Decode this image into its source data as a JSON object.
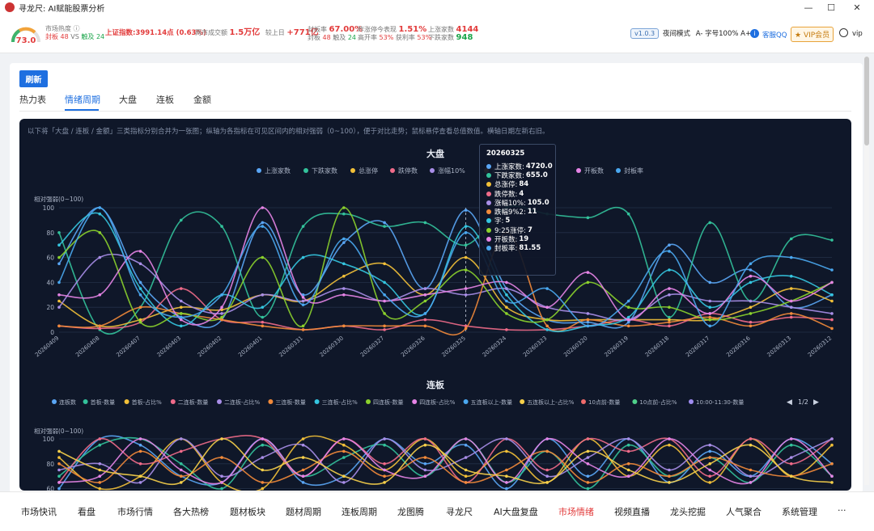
{
  "window": {
    "title": "寻龙尺: AI赋能股票分析",
    "controls": [
      "—",
      "☐",
      "✕"
    ]
  },
  "topbar": {
    "heat_label": "市场热度",
    "heat_value": "73.0",
    "seal_text": "封板",
    "seal_num": "48",
    "vs": "VS",
    "break_text": "触及",
    "break_num": "24",
    "index_label": "上证指数:",
    "index_value": "3991.14点 (0.63%)",
    "turnover_label": "两市成交额",
    "turnover_value": "1.5万亿",
    "compare_label": "较上日",
    "compare_value": "+771亿",
    "seal_rate_label": "封板率",
    "seal_rate_value": "67.00%",
    "seal_rate_sub1": "封板",
    "seal_rate_sub1_num": "48",
    "seal_rate_sub2": "触及",
    "seal_rate_sub2_num": "24",
    "yest_label": "昨涨停今表现",
    "yest_value": "1.51%",
    "high_open_label": "高开率",
    "high_open_value": "53%",
    "profit_label": "获利率",
    "profit_value": "53%",
    "up_label": "上涨家数",
    "up_value": "4144",
    "down_label": "下跌家数",
    "down_value": "948",
    "version": "v1.0.3",
    "night_mode": "夜间模式",
    "font_minus": "A-",
    "font_size": "字号100%",
    "font_plus": "A+",
    "qq": "客服QQ",
    "vip_btn": "VIP会员",
    "user": "vip"
  },
  "page": {
    "refresh": "刷新",
    "tabs": [
      "热力表",
      "情绪周期",
      "大盘",
      "连板",
      "金额"
    ],
    "active_tab": 1,
    "description": "以下将「大盘 / 连板 / 金额」三类指标分别合并为一张图；纵轴为各指标在可见区间内的相对强弱（0~100），便于对比走势；鼠标悬停查看总值数值。横轴日期左新右旧。"
  },
  "tooltip": {
    "date": "20260325",
    "rows": [
      {
        "name": "上涨家数",
        "value": "4720.0",
        "color": "#5aa6f5"
      },
      {
        "name": "下跌家数",
        "value": "655.0",
        "color": "#33c29b"
      },
      {
        "name": "总涨停",
        "value": "84",
        "color": "#f2c038"
      },
      {
        "name": "跌停数",
        "value": "4",
        "color": "#f06b8a"
      },
      {
        "name": "涨幅10%",
        "value": "105.0",
        "color": "#a98ee8"
      },
      {
        "name": "跌幅9%2",
        "value": "11",
        "color": "#f28a3a"
      },
      {
        "name": "字",
        "value": "5",
        "color": "#35c6e0"
      },
      {
        "name": "9:25涨停",
        "value": "7",
        "color": "#8bd12c"
      },
      {
        "name": "开板数",
        "value": "19",
        "color": "#e684e6"
      },
      {
        "name": "封板率",
        "value": "81.55",
        "color": "#4aa8f0"
      }
    ]
  },
  "bottom_nav": [
    "市场快讯",
    "看盘",
    "市场行情",
    "各大热榜",
    "题材板块",
    "题材周期",
    "连板周期",
    "龙图腾",
    "寻龙尺",
    "AI大盘复盘",
    "市场情绪",
    "视频直播",
    "龙头挖掘",
    "人气聚合",
    "系统管理",
    "···"
  ],
  "bottom_active": 10,
  "chart_data": [
    {
      "type": "line",
      "title": "大盘",
      "ylabel": "相对强弱(0~100)",
      "ylim": [
        0,
        100
      ],
      "yticks": [
        0,
        20,
        40,
        60,
        80,
        100
      ],
      "categories": [
        "20260409",
        "20260408",
        "20260407",
        "20260403",
        "20260402",
        "20260401",
        "20260331",
        "20260330",
        "20260327",
        "20260326",
        "20260325",
        "20260324",
        "20260323",
        "20260320",
        "20260319",
        "20260318",
        "20260317",
        "20260316",
        "20260313",
        "20260312"
      ],
      "legend": [
        "上涨家数",
        "下跌家数",
        "总涨停",
        "跌停数",
        "涨幅10%",
        "跌幅9%",
        "",
        "",
        "开板数",
        "封板率"
      ],
      "legend_position": "top",
      "grid": true,
      "series": [
        {
          "name": "上涨家数",
          "color": "#5aa6f5",
          "values": [
            55,
            100,
            40,
            12,
            10,
            88,
            30,
            72,
            88,
            35,
            98,
            35,
            10,
            8,
            8,
            70,
            40,
            50,
            20,
            30
          ]
        },
        {
          "name": "下跌家数",
          "color": "#33c29b",
          "values": [
            80,
            2,
            20,
            90,
            85,
            12,
            85,
            95,
            85,
            88,
            70,
            100,
            95,
            92,
            95,
            12,
            88,
            25,
            75,
            74
          ]
        },
        {
          "name": "总涨停",
          "color": "#f2c038",
          "values": [
            25,
            5,
            10,
            20,
            18,
            30,
            25,
            45,
            55,
            30,
            60,
            20,
            10,
            10,
            10,
            10,
            10,
            20,
            35,
            25
          ]
        },
        {
          "name": "跌停数",
          "color": "#f06b8a",
          "values": [
            5,
            3,
            8,
            35,
            10,
            8,
            2,
            5,
            2,
            10,
            5,
            2,
            2,
            5,
            10,
            5,
            15,
            8,
            12,
            10
          ]
        },
        {
          "name": "涨幅10%",
          "color": "#a98ee8",
          "values": [
            20,
            60,
            55,
            25,
            15,
            30,
            25,
            35,
            25,
            35,
            30,
            35,
            20,
            15,
            10,
            30,
            25,
            25,
            20,
            15
          ]
        },
        {
          "name": "跌幅9%",
          "color": "#f28a3a",
          "values": [
            5,
            5,
            20,
            15,
            10,
            5,
            2,
            5,
            5,
            5,
            3,
            80,
            5,
            10,
            5,
            8,
            12,
            5,
            15,
            3
          ]
        },
        {
          "name": "",
          "color": "#35c6e0",
          "values": [
            70,
            95,
            35,
            5,
            30,
            20,
            60,
            55,
            40,
            15,
            85,
            30,
            2,
            5,
            12,
            50,
            20,
            40,
            45,
            30
          ]
        },
        {
          "name": "",
          "color": "#8bd12c",
          "values": [
            60,
            80,
            8,
            15,
            12,
            60,
            5,
            100,
            15,
            25,
            50,
            15,
            10,
            40,
            20,
            20,
            10,
            15,
            25,
            40
          ]
        },
        {
          "name": "开板数",
          "color": "#e684e6",
          "values": [
            30,
            30,
            65,
            10,
            20,
            100,
            28,
            30,
            25,
            30,
            35,
            40,
            20,
            48,
            10,
            35,
            15,
            45,
            25,
            40
          ]
        },
        {
          "name": "封板率",
          "color": "#4aa8f0",
          "values": [
            40,
            100,
            30,
            12,
            30,
            85,
            22,
            75,
            30,
            15,
            80,
            25,
            35,
            5,
            25,
            65,
            5,
            55,
            60,
            50
          ]
        }
      ]
    },
    {
      "type": "line",
      "title": "连板",
      "ylabel": "相对强弱(0~100)",
      "ylim": [
        0,
        100
      ],
      "yticks": [
        60,
        80,
        100
      ],
      "legend": [
        "连板数",
        "首板-数量",
        "首板-占比%",
        "二连板-数量",
        "二连板-占比%",
        "三连板-数量",
        "三连板-占比%",
        "四连板-数量",
        "四连板-占比%",
        "五连板以上-数量",
        "五连板以上-占比%",
        "10点前-数量",
        "10点前-占比%",
        "10:00-11:30-数量"
      ],
      "legend_page": "1/2",
      "grid": true,
      "series": [
        {
          "name": "连板数",
          "color": "#5aa6f5",
          "values": [
            60,
            100,
            95,
            70,
            65,
            100,
            65,
            70,
            100,
            80,
            95,
            60,
            100,
            70,
            100,
            65,
            90,
            70,
            100,
            80
          ]
        },
        {
          "name": "首板-数量",
          "color": "#33c29b",
          "values": [
            70,
            95,
            100,
            80,
            60,
            95,
            70,
            85,
            95,
            70,
            100,
            65,
            90,
            60,
            95,
            70,
            85,
            65,
            95,
            70
          ]
        },
        {
          "name": "首板-占比%",
          "color": "#f2c038",
          "values": [
            85,
            60,
            70,
            100,
            65,
            60,
            100,
            95,
            75,
            100,
            70,
            90,
            65,
            100,
            70,
            95,
            65,
            100,
            70,
            95
          ]
        },
        {
          "name": "二连板-数量",
          "color": "#f06b8a",
          "values": [
            65,
            100,
            80,
            90,
            100,
            100,
            70,
            100,
            80,
            100,
            65,
            100,
            75,
            100,
            90,
            100,
            70,
            100,
            80,
            100
          ]
        },
        {
          "name": "二连板-占比%",
          "color": "#a98ee8",
          "values": [
            75,
            80,
            65,
            100,
            70,
            85,
            95,
            65,
            100,
            75,
            85,
            100,
            70,
            85,
            100,
            75,
            95,
            70,
            85,
            100
          ]
        },
        {
          "name": "三连板-数量",
          "color": "#f28a3a",
          "values": [
            80,
            65,
            90,
            70,
            85,
            65,
            75,
            90,
            70,
            85,
            65,
            75,
            90,
            65,
            80,
            70,
            85,
            75,
            70,
            80
          ]
        },
        {
          "name": "四连板-占比%",
          "color": "#e684e6",
          "values": [
            65,
            70,
            100,
            75,
            65,
            100,
            70,
            100,
            75,
            70,
            100,
            65,
            100,
            80,
            70,
            100,
            75,
            65,
            100,
            70
          ]
        },
        {
          "name": "五连板以上-占比%",
          "color": "#f7d04a",
          "values": [
            90,
            75,
            70,
            65,
            100,
            75,
            85,
            70,
            65,
            95,
            75,
            70,
            65,
            90,
            75,
            65,
            80,
            95,
            70,
            65
          ]
        }
      ]
    }
  ]
}
